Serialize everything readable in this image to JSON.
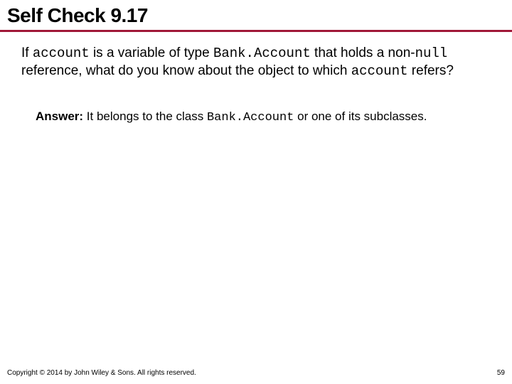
{
  "title": "Self Check 9.17",
  "question": {
    "pre1": "If ",
    "code1": "account",
    "mid1": " is a variable of type ",
    "code2": "Bank.Account",
    "mid2": " that holds a non-",
    "code3": "null",
    "post": " reference, what do you know about the object to which ",
    "code4": "account",
    "end": " refers?"
  },
  "answer": {
    "label": "Answer:",
    "pre": " It belongs to the class ",
    "code": "Bank.Account",
    "post": " or one of its subclasses."
  },
  "footer": {
    "copyright": "Copyright © 2014 by John Wiley & Sons. All rights reserved.",
    "page": "59"
  }
}
